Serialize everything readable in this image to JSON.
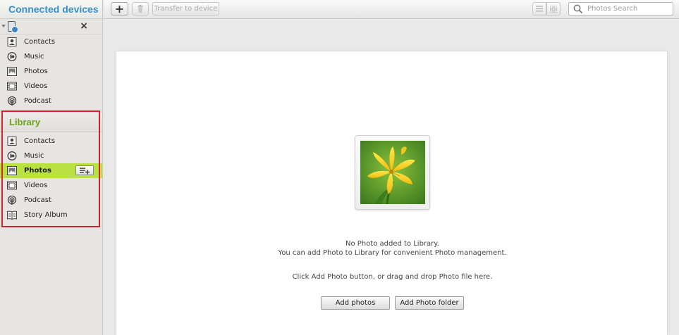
{
  "sidebar": {
    "connected_title": "Connected devices",
    "device_close": "×",
    "device_items": [
      {
        "label": "Contacts",
        "icon": "contacts-icon"
      },
      {
        "label": "Music",
        "icon": "music-icon"
      },
      {
        "label": "Photos",
        "icon": "photos-icon"
      },
      {
        "label": "Videos",
        "icon": "videos-icon"
      },
      {
        "label": "Podcast",
        "icon": "podcast-icon"
      }
    ],
    "library_title": "Library",
    "library_items": [
      {
        "label": "Contacts",
        "icon": "contacts-icon"
      },
      {
        "label": "Music",
        "icon": "music-icon"
      },
      {
        "label": "Photos",
        "icon": "photos-icon",
        "active": true
      },
      {
        "label": "Videos",
        "icon": "videos-icon"
      },
      {
        "label": "Podcast",
        "icon": "podcast-icon"
      },
      {
        "label": "Story Album",
        "icon": "story-album-icon"
      }
    ],
    "active_color": "#b9e13f",
    "highlight_color": "#d6202b"
  },
  "toolbar": {
    "add_label": "+",
    "transfer_label": "Transfer to device",
    "search_placeholder": "Photos Search"
  },
  "main": {
    "line1": "No Photo added to Library.",
    "line2": "You can add Photo to Library for convenient Photo management.",
    "line3": "Click Add Photo button, or drag and drop Photo file here.",
    "add_photos_label": "Add photos",
    "add_folder_label": "Add Photo folder"
  },
  "colors": {
    "connected_title": "#3b8fc7",
    "library_title": "#6aa31c"
  }
}
